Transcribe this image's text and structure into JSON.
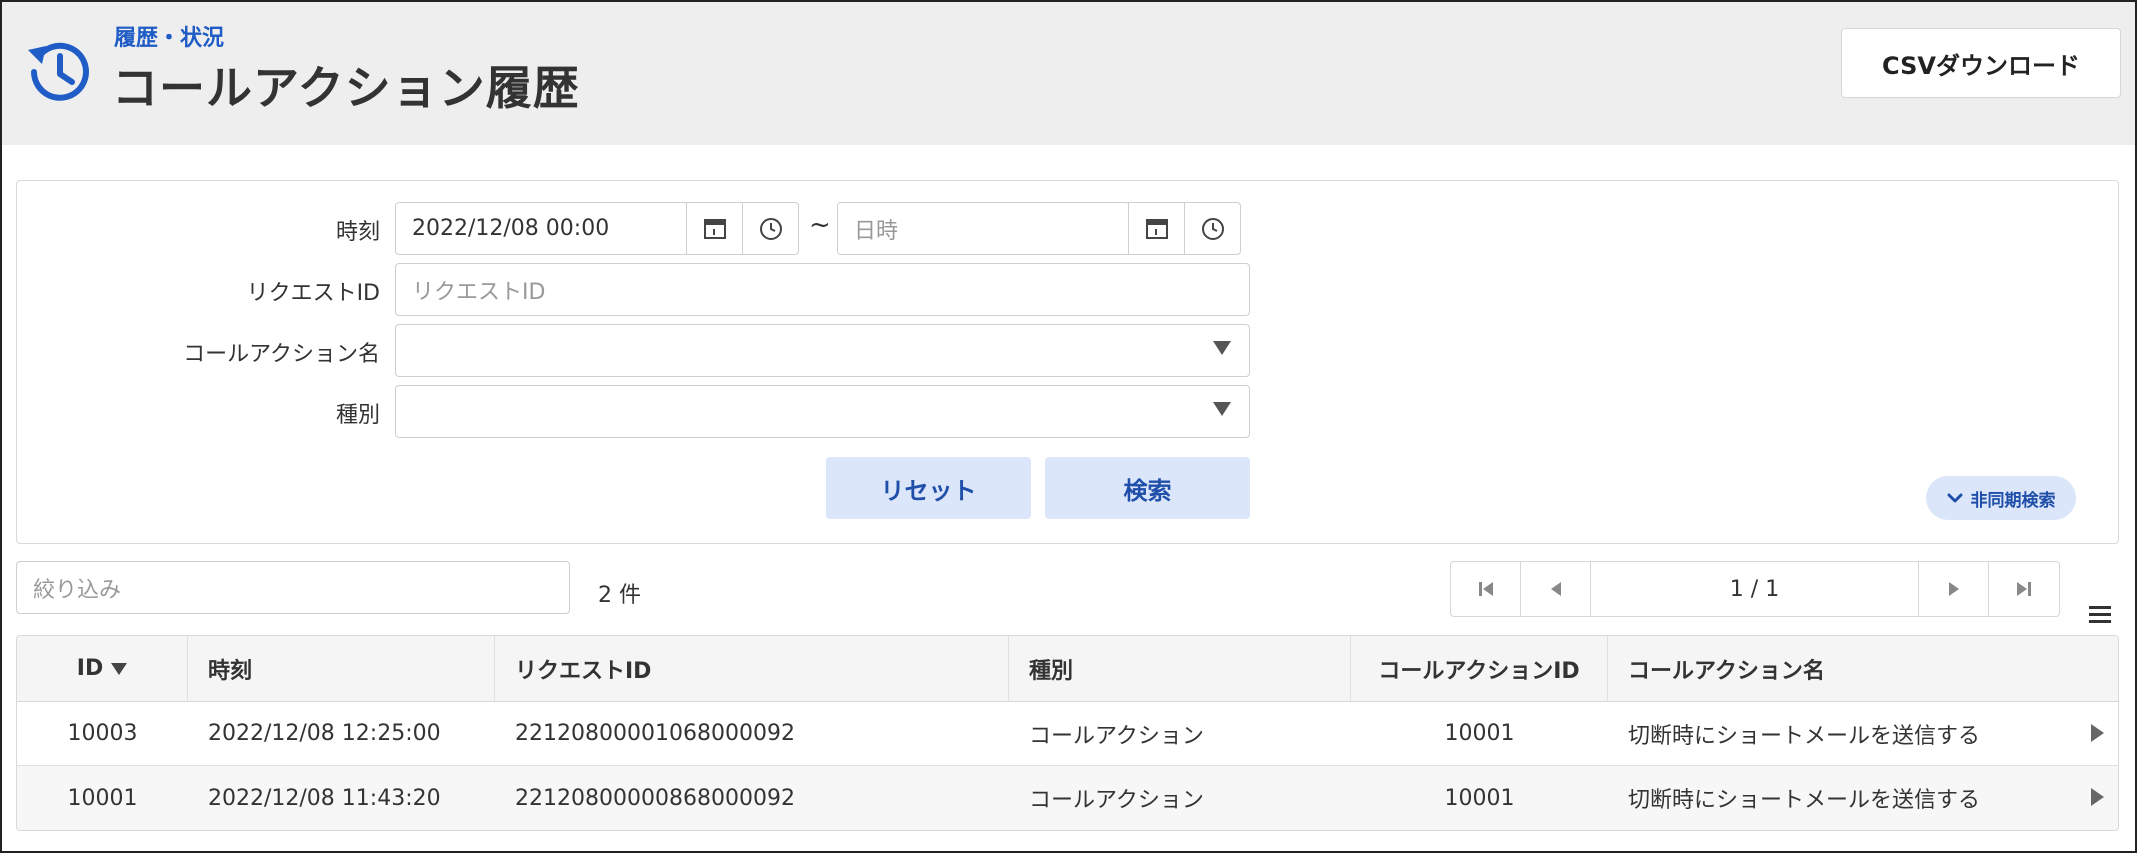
{
  "header": {
    "subtitle": "履歴・状況",
    "title": "コールアクション履歴",
    "csv_button": "CSVダウンロード",
    "icon": "history-icon"
  },
  "search": {
    "time_label": "時刻",
    "time_from_value": "2022/12/08 00:00",
    "time_separator": "~",
    "time_to_placeholder": "日時",
    "request_id_label": "リクエストID",
    "request_id_placeholder": "リクエストID",
    "call_action_name_label": "コールアクション名",
    "call_action_name_value": "",
    "type_label": "種別",
    "type_value": "",
    "reset_button": "リセット",
    "search_button": "検索",
    "async_search_button": "非同期検索"
  },
  "toolbar": {
    "filter_placeholder": "絞り込み",
    "count": "2 件",
    "page": "1 / 1"
  },
  "table": {
    "columns": [
      "ID",
      "時刻",
      "リクエストID",
      "種別",
      "コールアクションID",
      "コールアクション名"
    ],
    "rows": [
      [
        "10003",
        "2022/12/08 12:25:00",
        "22120800001068000092",
        "コールアクション",
        "10001",
        "切断時にショートメールを送信する"
      ],
      [
        "10001",
        "2022/12/08 11:43:20",
        "22120800000868000092",
        "コールアクション",
        "10001",
        "切断時にショートメールを送信する"
      ]
    ]
  },
  "colors": {
    "accent": "#1f5cc6",
    "button_bg": "#dce6fb",
    "header_bg": "#eeeeee"
  }
}
